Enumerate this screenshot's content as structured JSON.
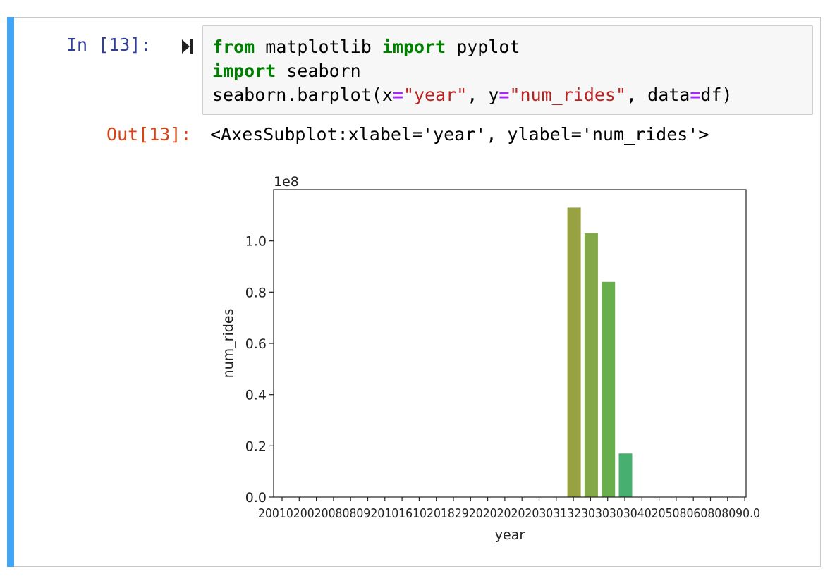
{
  "cell": {
    "in_prompt": "In [13]:",
    "out_prompt": "Out[13]:",
    "run_icon": "run-cell-icon",
    "code": {
      "line1": {
        "kw1": "from",
        "t1": " matplotlib ",
        "kw2": "import",
        "t2": " pyplot"
      },
      "line2": {
        "kw1": "import",
        "t1": " seaborn"
      },
      "line3": {
        "t1": "seaborn.barplot(x",
        "op1": "=",
        "s1": "\"year\"",
        "t2": ", y",
        "op2": "=",
        "s2": "\"num_rides\"",
        "t3": ", data",
        "op3": "=",
        "t4": "df)"
      }
    },
    "output_text": "<AxesSubplot:xlabel='year', ylabel='num_rides'>",
    "colors": {
      "accent_bar": "#42a5f5",
      "in_prompt": "#303f9f",
      "out_prompt": "#d84315",
      "keyword": "#008000",
      "string": "#ba2121",
      "operator": "#aa22ff"
    }
  },
  "chart_data": {
    "type": "bar",
    "xlabel": "year",
    "ylabel": "num_rides",
    "offset_label": "1e8",
    "ylim": [
      0,
      1.2
    ],
    "yticks": [
      "0.0",
      "0.2",
      "0.4",
      "0.6",
      "0.8",
      "1.0"
    ],
    "xtick_label_row": "2001020020080809201016102018292020202020303132303030304020508060808090.0",
    "categories": [
      "2000",
      "2001",
      "2002",
      "2003",
      "2004",
      "2005",
      "2006",
      "2007",
      "2008",
      "2009",
      "2010",
      "2011",
      "2012",
      "2013",
      "2014",
      "2015",
      "2016",
      "2017",
      "2018",
      "2019",
      "2020",
      "2021",
      "2022",
      "2023",
      "2024",
      "2025",
      "2026",
      "2027",
      "2028",
      "2029",
      "2030",
      "2031",
      "2032",
      "2033",
      "2034",
      "2035",
      "2036",
      "2037",
      "2038",
      "2039",
      "2040",
      "2041",
      "2042",
      "2043",
      "2044",
      "2045",
      "2046",
      "2047",
      "2048",
      "2049",
      "2050"
    ],
    "series": [
      {
        "values": [
          0,
          0,
          0,
          0,
          0,
          0,
          0,
          0,
          0,
          0,
          0,
          0,
          0,
          0,
          0,
          0,
          0,
          1.13,
          1.03,
          0.84,
          0.17,
          0,
          0,
          0,
          0,
          0,
          0,
          0,
          0,
          0,
          0,
          0,
          0,
          0,
          0,
          0,
          0,
          0,
          0,
          0,
          0,
          0,
          0,
          0,
          0,
          0,
          0,
          0,
          0,
          0,
          0
        ]
      }
    ],
    "bar_colors": [
      "#98a243",
      "#82a847",
      "#68ae4a",
      "#47b070"
    ],
    "grid": false,
    "legend": "none"
  }
}
